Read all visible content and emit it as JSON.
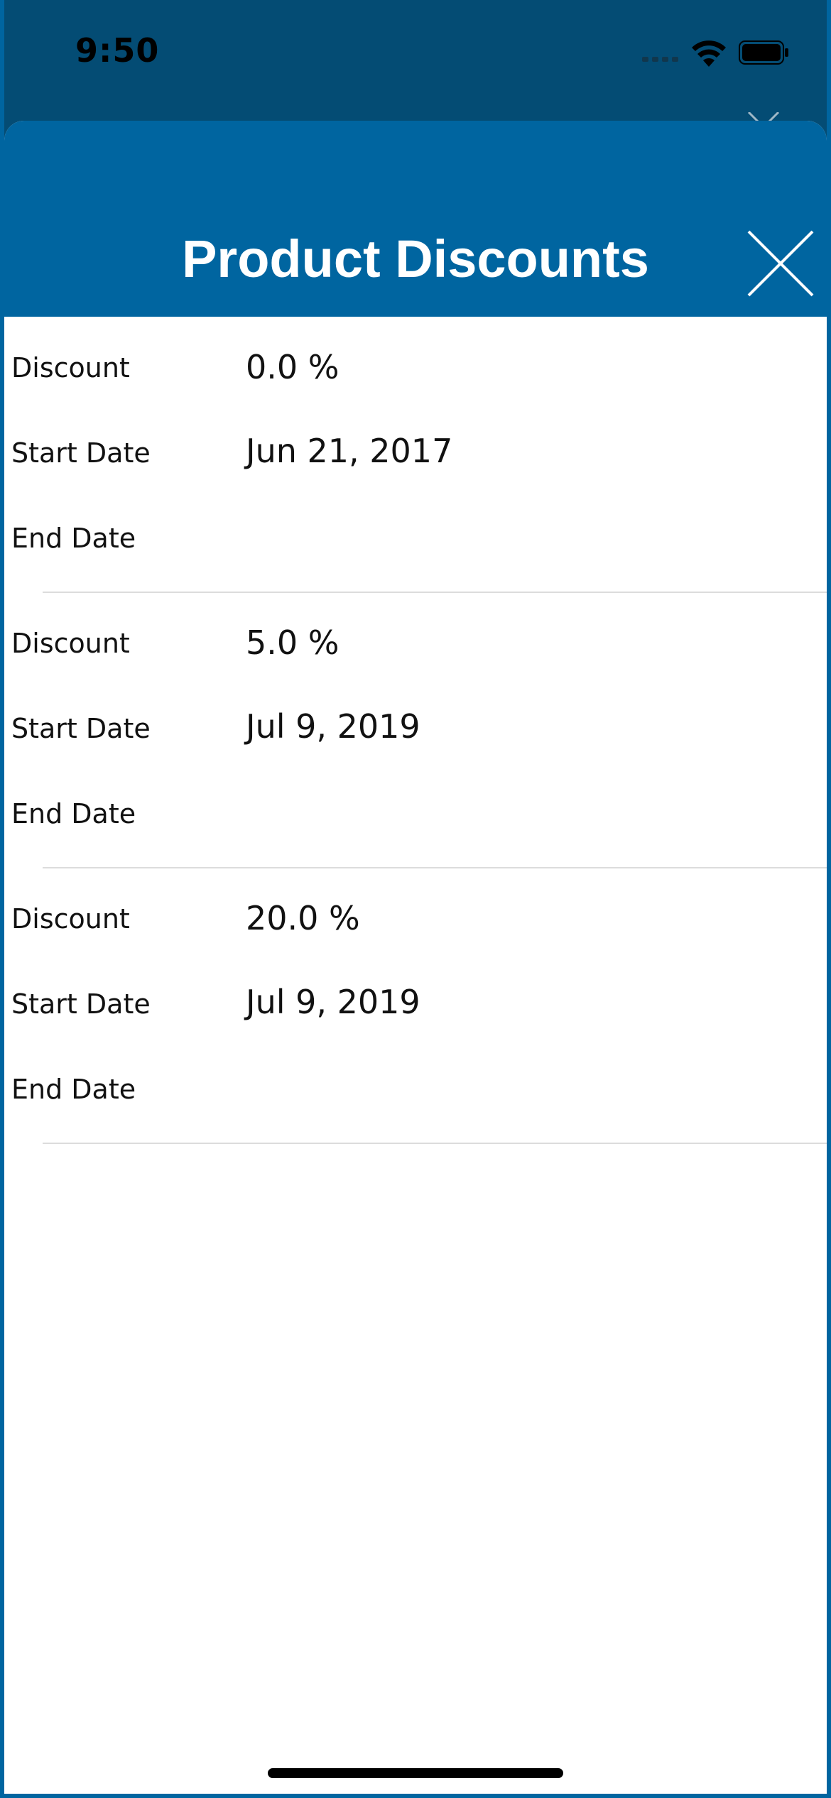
{
  "status_bar": {
    "time": "9:50"
  },
  "sheet": {
    "title": "Product Discounts"
  },
  "labels": {
    "discount": "Discount",
    "start_date": "Start Date",
    "end_date": "End Date"
  },
  "discounts": [
    {
      "discount": "0.0 %",
      "start_date": "Jun 21, 2017",
      "end_date": ""
    },
    {
      "discount": "5.0 %",
      "start_date": "Jul 9, 2019",
      "end_date": ""
    },
    {
      "discount": "20.0 %",
      "start_date": "Jul 9, 2019",
      "end_date": ""
    }
  ],
  "colors": {
    "header": "#0065a0",
    "background_dim": "#044c74",
    "divider": "#dcdcdc"
  },
  "icons": [
    "wifi-icon",
    "battery-icon",
    "cellular-signal-icon",
    "close-icon"
  ]
}
